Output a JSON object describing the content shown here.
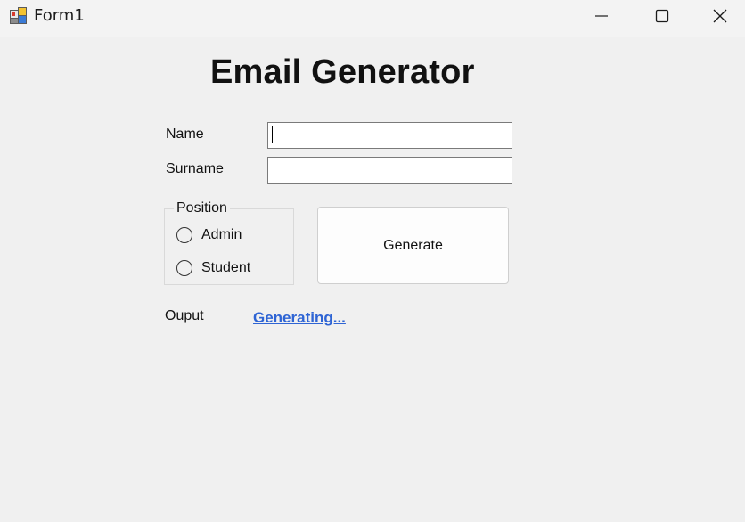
{
  "window": {
    "title": "Form1",
    "icon": "winforms-app-icon",
    "controls": {
      "minimize_icon": "minimize-icon",
      "maximize_icon": "maximize-icon",
      "close_icon": "close-icon"
    }
  },
  "form": {
    "heading": "Email Generator",
    "name_label": "Name",
    "name_value": "",
    "surname_label": "Surname",
    "surname_value": "",
    "position_group": {
      "legend": "Position",
      "options": [
        "Admin",
        "Student"
      ],
      "selected": null
    },
    "generate_label": "Generate",
    "output_label": "Ouput",
    "output_link": "Generating..."
  },
  "colors": {
    "background": "#f0f0f0",
    "link": "#2e64d4"
  }
}
